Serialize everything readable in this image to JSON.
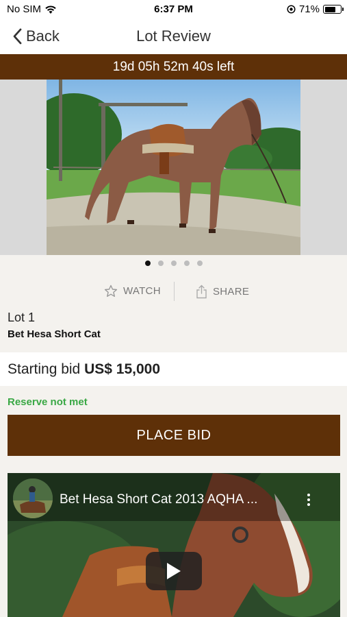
{
  "status_bar": {
    "carrier": "No SIM",
    "time": "6:37 PM",
    "battery": "71%",
    "battery_level": 0.71
  },
  "nav": {
    "back_label": "Back",
    "title": "Lot Review"
  },
  "countdown": {
    "text": "19d 05h 52m 40s left"
  },
  "gallery": {
    "image_count": 5,
    "active_index": 0
  },
  "actions": {
    "watch_label": "WATCH",
    "share_label": "SHARE"
  },
  "lot": {
    "number_label": "Lot 1",
    "name": "Bet Hesa Short Cat"
  },
  "bid": {
    "starting_label": "Starting bid",
    "amount": "US$ 15,000"
  },
  "reserve_status": "Reserve not met",
  "place_bid_label": "PLACE BID",
  "video": {
    "title": "Bet Hesa Short Cat 2013 AQHA ..."
  },
  "colors": {
    "brand": "#5e3008",
    "reserve": "#3aa845",
    "background": "#f4f2ee"
  },
  "icons": [
    "wifi-icon",
    "location-icon",
    "battery-icon",
    "chevron-left-icon",
    "star-icon",
    "share-icon",
    "more-vertical-icon",
    "play-icon"
  ]
}
